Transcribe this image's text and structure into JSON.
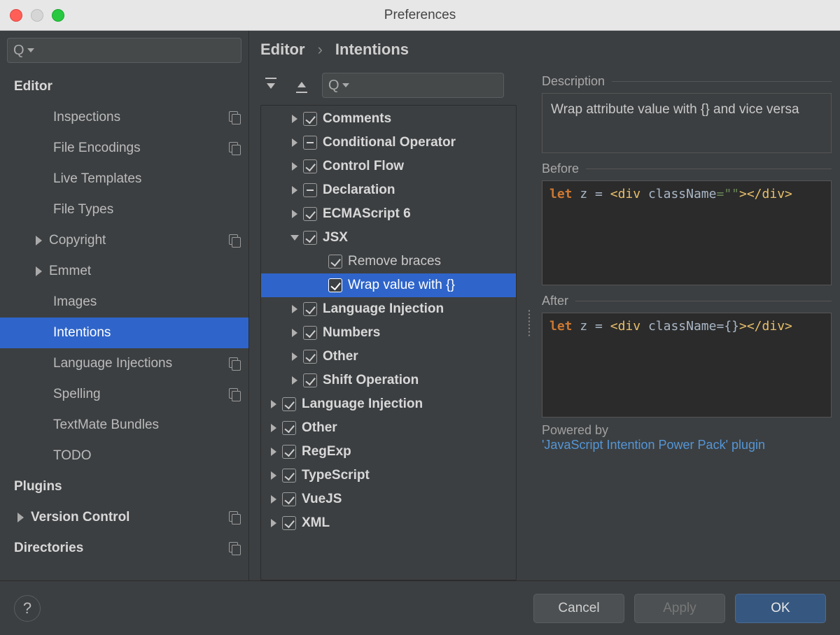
{
  "window_title": "Preferences",
  "breadcrumb": {
    "root": "Editor",
    "leaf": "Intentions",
    "sep": "›"
  },
  "sidebar": {
    "items": [
      {
        "label": "Editor",
        "bold": true,
        "indent": 0,
        "arrow": false,
        "copy": false
      },
      {
        "label": "Inspections",
        "bold": false,
        "indent": 2,
        "arrow": false,
        "copy": true
      },
      {
        "label": "File Encodings",
        "bold": false,
        "indent": 2,
        "arrow": false,
        "copy": true
      },
      {
        "label": "Live Templates",
        "bold": false,
        "indent": 2,
        "arrow": false,
        "copy": false
      },
      {
        "label": "File Types",
        "bold": false,
        "indent": 2,
        "arrow": false,
        "copy": false
      },
      {
        "label": "Copyright",
        "bold": false,
        "indent": 1,
        "arrow": true,
        "copy": true
      },
      {
        "label": "Emmet",
        "bold": false,
        "indent": 1,
        "arrow": true,
        "copy": false
      },
      {
        "label": "Images",
        "bold": false,
        "indent": 2,
        "arrow": false,
        "copy": false
      },
      {
        "label": "Intentions",
        "bold": false,
        "indent": 2,
        "arrow": false,
        "copy": false,
        "selected": true
      },
      {
        "label": "Language Injections",
        "bold": false,
        "indent": 2,
        "arrow": false,
        "copy": true
      },
      {
        "label": "Spelling",
        "bold": false,
        "indent": 2,
        "arrow": false,
        "copy": true
      },
      {
        "label": "TextMate Bundles",
        "bold": false,
        "indent": 2,
        "arrow": false,
        "copy": false
      },
      {
        "label": "TODO",
        "bold": false,
        "indent": 2,
        "arrow": false,
        "copy": false
      },
      {
        "label": "Plugins",
        "bold": true,
        "indent": 0,
        "arrow": false,
        "copy": false
      },
      {
        "label": "Version Control",
        "bold": true,
        "indent": 0,
        "arrow": true,
        "copy": true
      },
      {
        "label": "Directories",
        "bold": true,
        "indent": 0,
        "arrow": false,
        "copy": true
      }
    ]
  },
  "intentions": [
    {
      "label": "Comments",
      "depth": 1,
      "arrow": "right",
      "state": "checked",
      "bold": true
    },
    {
      "label": "Conditional Operator",
      "depth": 1,
      "arrow": "right",
      "state": "mixed",
      "bold": true
    },
    {
      "label": "Control Flow",
      "depth": 1,
      "arrow": "right",
      "state": "checked",
      "bold": true
    },
    {
      "label": "Declaration",
      "depth": 1,
      "arrow": "right",
      "state": "mixed",
      "bold": true
    },
    {
      "label": "ECMAScript 6",
      "depth": 1,
      "arrow": "right",
      "state": "checked",
      "bold": true
    },
    {
      "label": "JSX",
      "depth": 1,
      "arrow": "down",
      "state": "checked",
      "bold": true
    },
    {
      "label": "Remove braces",
      "depth": 2,
      "arrow": "none",
      "state": "checked",
      "bold": false
    },
    {
      "label": "Wrap value with {}",
      "depth": 2,
      "arrow": "none",
      "state": "checked",
      "bold": false,
      "selected": true
    },
    {
      "label": "Language Injection",
      "depth": 1,
      "arrow": "right",
      "state": "checked",
      "bold": true
    },
    {
      "label": "Numbers",
      "depth": 1,
      "arrow": "right",
      "state": "checked",
      "bold": true
    },
    {
      "label": "Other",
      "depth": 1,
      "arrow": "right",
      "state": "checked",
      "bold": true
    },
    {
      "label": "Shift Operation",
      "depth": 1,
      "arrow": "right",
      "state": "checked",
      "bold": true
    },
    {
      "label": "Language Injection",
      "depth": 0,
      "arrow": "right",
      "state": "checked",
      "bold": true
    },
    {
      "label": "Other",
      "depth": 0,
      "arrow": "right",
      "state": "checked",
      "bold": true
    },
    {
      "label": "RegExp",
      "depth": 0,
      "arrow": "right",
      "state": "checked",
      "bold": true
    },
    {
      "label": "TypeScript",
      "depth": 0,
      "arrow": "right",
      "state": "checked",
      "bold": true
    },
    {
      "label": "VueJS",
      "depth": 0,
      "arrow": "right",
      "state": "checked",
      "bold": true
    },
    {
      "label": "XML",
      "depth": 0,
      "arrow": "right",
      "state": "checked",
      "bold": true
    }
  ],
  "details": {
    "desc_label": "Description",
    "desc_text": "Wrap attribute value with {} and vice versa",
    "before_label": "Before",
    "after_label": "After",
    "before_code": {
      "kw": "let",
      "var": "z",
      "eq": "=",
      "open": "<div",
      "attr": "className",
      "val": "=\"\"",
      "close": ">",
      "endtag": "</div>"
    },
    "after_code": {
      "kw": "let",
      "var": "z",
      "eq": "=",
      "open": "<div",
      "attr": "className",
      "val": "={}",
      "close": ">",
      "endtag": "</div>"
    },
    "powered_label": "Powered by",
    "powered_link": "'JavaScript Intention Power Pack' plugin"
  },
  "footer": {
    "cancel": "Cancel",
    "apply": "Apply",
    "ok": "OK"
  }
}
